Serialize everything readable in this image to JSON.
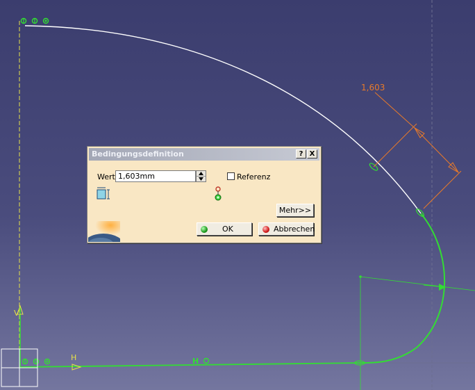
{
  "canvas": {
    "dimension_value": "1,603",
    "axis_v_label": "V",
    "axis_h_label": "H",
    "constraint_h_label": "H",
    "colors": {
      "background_top": "#3b3d6e",
      "background_bottom": "#74769f",
      "curve_white": "#ffffff",
      "curve_green": "#33dd33",
      "dimension_orange": "#e87a2a",
      "axis_yellow": "#e6e14a"
    }
  },
  "dialog": {
    "title": "Bedingungsdefinition",
    "help_label": "?",
    "close_label": "X",
    "wert_label": "Wert",
    "wert_value": "1,603mm",
    "referenz_label": "Referenz",
    "referenz_checked": false,
    "mehr_label": "Mehr>>",
    "ok_label": "OK",
    "abbrechen_label": "Abbrechen"
  }
}
